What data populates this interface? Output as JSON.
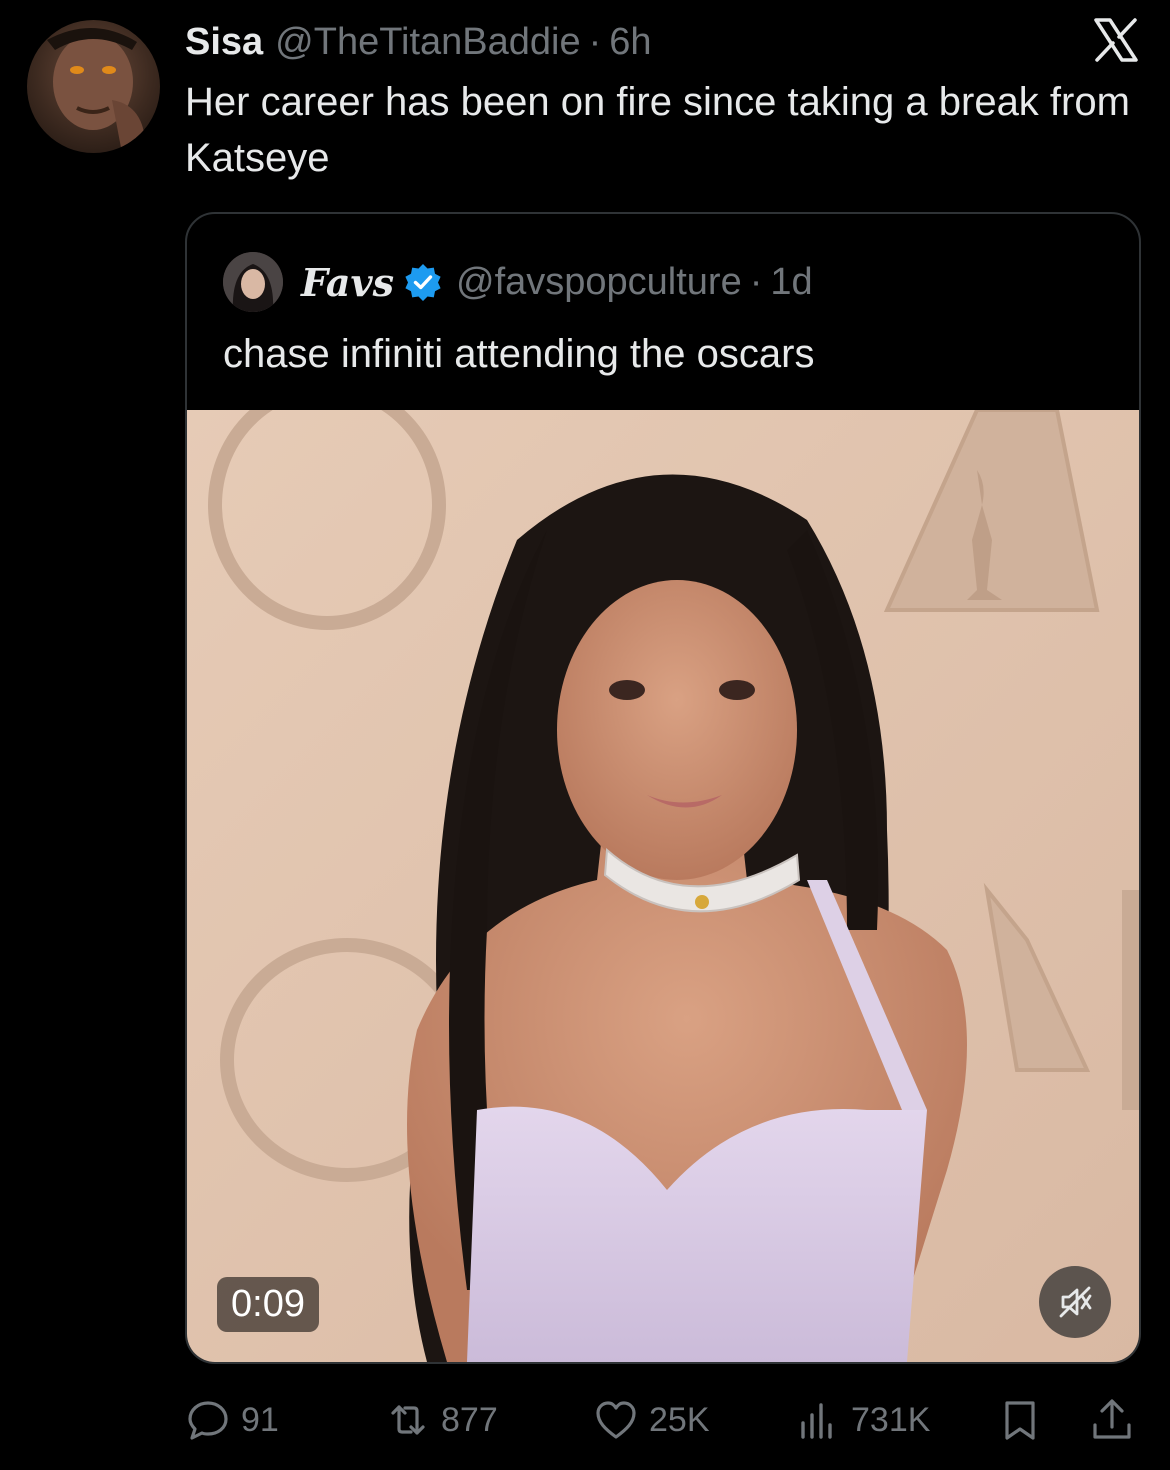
{
  "tweet": {
    "author_name": "Sisa",
    "author_handle": "@TheTitanBaddie",
    "separator": "·",
    "time": "6h",
    "text": "Her career has been on fire since taking a break from Katseye"
  },
  "quote": {
    "author_name": "Favs",
    "author_handle": "@favspopculture",
    "separator": "·",
    "time": "1d",
    "text": "chase infiniti attending the oscars",
    "video_duration": "0:09"
  },
  "actions": {
    "replies": "91",
    "reposts": "877",
    "likes": "25K",
    "views": "731K"
  },
  "colors": {
    "background": "#000000",
    "text": "#e7e9ea",
    "muted": "#71767b",
    "border": "#2f3336",
    "verified": "#1d9bf0"
  },
  "icons": [
    "x-logo-icon",
    "verified-badge-icon",
    "mute-icon",
    "reply-icon",
    "repost-icon",
    "like-icon",
    "views-icon",
    "bookmark-icon",
    "share-icon"
  ]
}
